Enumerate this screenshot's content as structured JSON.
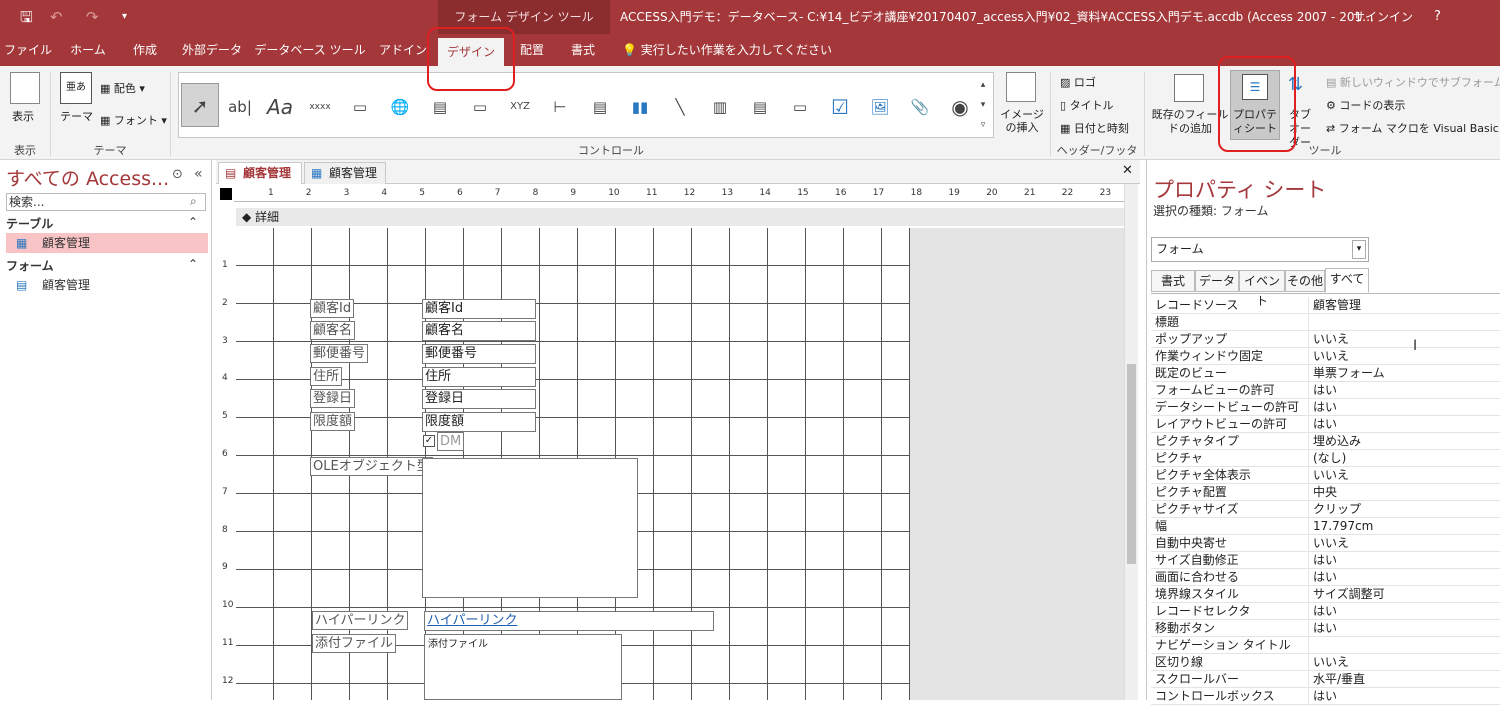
{
  "title_bar": {
    "context_label": "フォーム デザイン ツール",
    "document_title": "ACCESS入門デモ：データベース- C:¥14_ビデオ講座¥20170407_access入門¥02_資料¥ACCESS入門デモ.accdb (Access 2007 - 201…",
    "signin": "サインイン",
    "help": "?"
  },
  "menu": {
    "tabs": [
      "ファイル",
      "ホーム",
      "作成",
      "外部データ",
      "データベース ツール",
      "アドイン",
      "デザイン",
      "配置",
      "書式"
    ],
    "active_tab": "デザイン",
    "tell_me": "実行したい作業を入力してください"
  },
  "ribbon": {
    "view_label": "表示",
    "view_group": "表示",
    "theme_label": "テーマ",
    "colors_label": "配色",
    "fonts_label": "フォント",
    "theme_group": "テーマ",
    "controls_group": "コントロール",
    "insert_image_label": "イメージの挿入",
    "logo_label": "ロゴ",
    "title_label": "タイトル",
    "datetime_label": "日付と時刻",
    "header_footer_group": "ヘッダー/フッター",
    "add_fields_label": "既存のフィールドの追加",
    "property_sheet_label": "プロパティシート",
    "tab_order_label": "タブオーダー",
    "subform_label": "新しいウィンドウでサブフォームを開",
    "view_code_label": "コードの表示",
    "convert_macros_label": "フォーム マクロを Visual Basic に",
    "tools_group": "ツール"
  },
  "nav_pane": {
    "header": "すべての Access...",
    "search_placeholder": "検索...",
    "sections": [
      {
        "title": "テーブル",
        "items": [
          {
            "label": "顧客管理"
          }
        ]
      },
      {
        "title": "フォーム",
        "items": [
          {
            "label": "顧客管理"
          }
        ]
      }
    ]
  },
  "doc_tabs": [
    {
      "label": "顧客管理"
    },
    {
      "label": "顧客管理"
    }
  ],
  "design": {
    "section_label": "詳細",
    "ruler_numbers": [
      "1",
      "2",
      "3",
      "4",
      "5",
      "6",
      "7",
      "8",
      "9",
      "10",
      "11",
      "12",
      "13",
      "14",
      "15",
      "16",
      "17",
      "18",
      "19",
      "20",
      "21",
      "22",
      "23"
    ],
    "vruler_numbers": [
      "1",
      "2",
      "3",
      "4",
      "5",
      "6",
      "7",
      "8",
      "9",
      "10",
      "11",
      "12"
    ],
    "fields": [
      {
        "label": "顧客Id",
        "control": "顧客Id"
      },
      {
        "label": "顧客名",
        "control": "顧客名"
      },
      {
        "label": "郵便番号",
        "control": "郵便番号"
      },
      {
        "label": "住所",
        "control": "住所"
      },
      {
        "label": "登録日",
        "control": "登録日"
      },
      {
        "label": "限度額",
        "control": "限度額"
      }
    ],
    "checkbox_label": "DM",
    "ole_label": "OLEオブジェクト型",
    "hyperlink_label": "ハイパーリンク",
    "hyperlink_control": "ハイパーリンク",
    "attachment_label": "添付ファイル",
    "attachment_control": "添付ファイル"
  },
  "property_sheet": {
    "title": "プロパティ シート",
    "selection_type": "選択の種類: フォーム",
    "object": "フォーム",
    "tabs": [
      "書式",
      "データ",
      "イベント",
      "その他",
      "すべて"
    ],
    "active_tab": "すべて",
    "rows": [
      {
        "k": "レコードソース",
        "v": "顧客管理"
      },
      {
        "k": "標題",
        "v": ""
      },
      {
        "k": "ポップアップ",
        "v": "いいえ"
      },
      {
        "k": "作業ウィンドウ固定",
        "v": "いいえ"
      },
      {
        "k": "既定のビュー",
        "v": "単票フォーム"
      },
      {
        "k": "フォームビューの許可",
        "v": "はい"
      },
      {
        "k": "データシートビューの許可",
        "v": "はい"
      },
      {
        "k": "レイアウトビューの許可",
        "v": "はい"
      },
      {
        "k": "ピクチャタイプ",
        "v": "埋め込み"
      },
      {
        "k": "ピクチャ",
        "v": "(なし)"
      },
      {
        "k": "ピクチャ全体表示",
        "v": "いいえ"
      },
      {
        "k": "ピクチャ配置",
        "v": "中央"
      },
      {
        "k": "ピクチャサイズ",
        "v": "クリップ"
      },
      {
        "k": "幅",
        "v": "17.797cm"
      },
      {
        "k": "自動中央寄せ",
        "v": "いいえ"
      },
      {
        "k": "サイズ自動修正",
        "v": "はい"
      },
      {
        "k": "画面に合わせる",
        "v": "はい"
      },
      {
        "k": "境界線スタイル",
        "v": "サイズ調整可"
      },
      {
        "k": "レコードセレクタ",
        "v": "はい"
      },
      {
        "k": "移動ボタン",
        "v": "はい"
      },
      {
        "k": "ナビゲーション タイトル",
        "v": ""
      },
      {
        "k": "区切り線",
        "v": "いいえ"
      },
      {
        "k": "スクロールバー",
        "v": "水平/垂直"
      },
      {
        "k": "コントロールボックス",
        "v": "はい"
      }
    ]
  },
  "colors": {
    "accent": "#a4373a",
    "selection": "#f8c4c6",
    "highlight_ring": "#e02020"
  }
}
